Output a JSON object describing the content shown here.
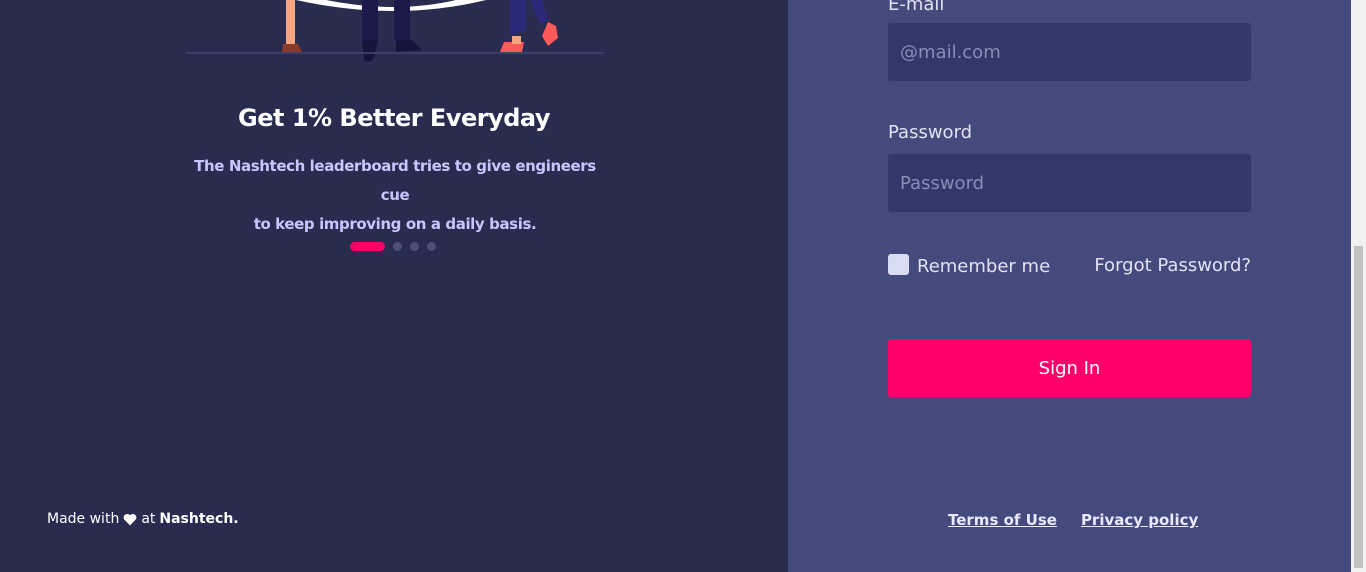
{
  "hero": {
    "title": "Get 1% Better Everyday",
    "subtitle_line1": "The Nashtech leaderboard tries to give engineers cue",
    "subtitle_line2": "to keep improving on a daily basis.",
    "carousel": {
      "count": 4,
      "active_index": 0
    }
  },
  "footer_left": {
    "prefix": "Made with",
    "connector": "at",
    "brand": "Nashtech."
  },
  "form": {
    "email_label": "E-mail",
    "email_placeholder": "@mail.com",
    "email_value": "",
    "password_label": "Password",
    "password_placeholder": "Password",
    "password_value": "",
    "remember_label": "Remember me",
    "remember_checked": false,
    "forgot_label": "Forgot Password?",
    "submit_label": "Sign In"
  },
  "footer_links": {
    "terms": "Terms of Use",
    "privacy": "Privacy policy"
  },
  "colors": {
    "left_bg": "#292b4f",
    "right_bg": "#454a7d",
    "input_bg": "#33376a",
    "accent": "#ff006b"
  },
  "icons": {
    "heart": "heart-icon",
    "illustration": "people-illustration"
  }
}
